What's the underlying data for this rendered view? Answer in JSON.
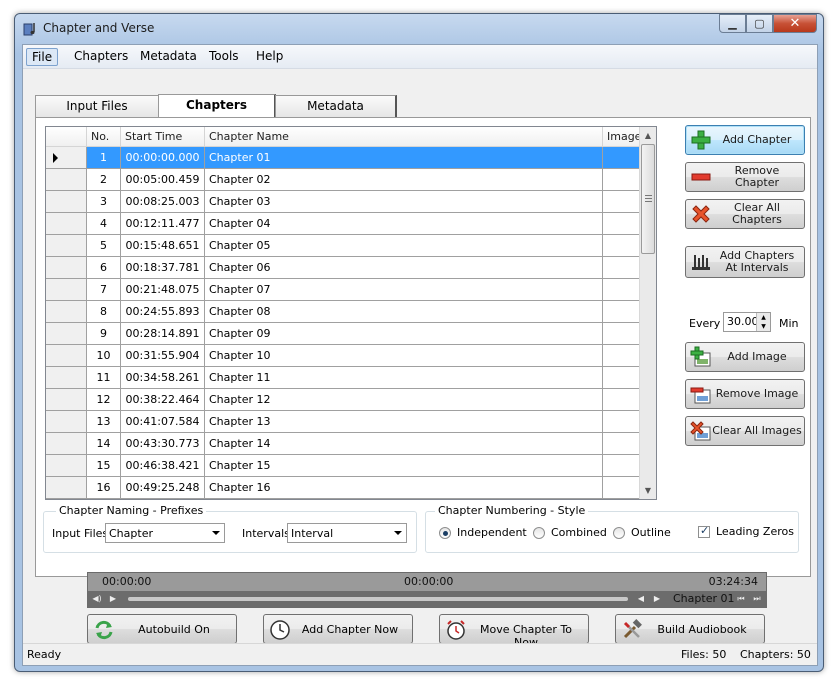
{
  "window": {
    "title": "Chapter and Verse"
  },
  "menu": [
    "File",
    "Chapters",
    "Metadata",
    "Tools",
    "Help"
  ],
  "tabs": [
    "Input Files",
    "Chapters",
    "Metadata"
  ],
  "grid": {
    "columns": [
      "No.",
      "Start Time",
      "Chapter Name",
      "Image"
    ],
    "rows": [
      {
        "no": "1",
        "time": "00:00:00.000",
        "name": "Chapter 01"
      },
      {
        "no": "2",
        "time": "00:05:00.459",
        "name": "Chapter 02"
      },
      {
        "no": "3",
        "time": "00:08:25.003",
        "name": "Chapter 03"
      },
      {
        "no": "4",
        "time": "00:12:11.477",
        "name": "Chapter 04"
      },
      {
        "no": "5",
        "time": "00:15:48.651",
        "name": "Chapter 05"
      },
      {
        "no": "6",
        "time": "00:18:37.781",
        "name": "Chapter 06"
      },
      {
        "no": "7",
        "time": "00:21:48.075",
        "name": "Chapter 07"
      },
      {
        "no": "8",
        "time": "00:24:55.893",
        "name": "Chapter 08"
      },
      {
        "no": "9",
        "time": "00:28:14.891",
        "name": "Chapter 09"
      },
      {
        "no": "10",
        "time": "00:31:55.904",
        "name": "Chapter 10"
      },
      {
        "no": "11",
        "time": "00:34:58.261",
        "name": "Chapter 11"
      },
      {
        "no": "12",
        "time": "00:38:22.464",
        "name": "Chapter 12"
      },
      {
        "no": "13",
        "time": "00:41:07.584",
        "name": "Chapter 13"
      },
      {
        "no": "14",
        "time": "00:43:30.773",
        "name": "Chapter 14"
      },
      {
        "no": "15",
        "time": "00:46:38.421",
        "name": "Chapter 15"
      },
      {
        "no": "16",
        "time": "00:49:25.248",
        "name": "Chapter 16"
      }
    ]
  },
  "side_buttons": {
    "add_chapter": "Add Chapter",
    "remove_chapter": "Remove Chapter",
    "clear_all_chapters": "Clear All Chapters",
    "add_chapters_intervals_1": "Add Chapters",
    "add_chapters_intervals_2": "At Intervals",
    "every_label": "Every",
    "interval_value": "30.00",
    "min_label": "Min",
    "add_image": "Add Image",
    "remove_image": "Remove Image",
    "clear_all_images": "Clear All Images"
  },
  "naming": {
    "group_title": "Chapter Naming - Prefixes",
    "input_files_label": "Input Files",
    "input_files_value": "Chapter",
    "intervals_label": "Intervals",
    "intervals_value": "Interval"
  },
  "numbering": {
    "group_title": "Chapter Numbering - Style",
    "options": [
      "Independent",
      "Combined",
      "Outline"
    ],
    "selected": "Independent",
    "leading_zeros": "Leading Zeros"
  },
  "player": {
    "time_left": "00:00:00",
    "time_center": "00:00:00",
    "time_right": "03:24:34",
    "chapter": "Chapter 01"
  },
  "actions": {
    "autobuild": "Autobuild On",
    "add_chapter_now": "Add Chapter Now",
    "move_chapter_to_now": "Move Chapter To Now",
    "build_audiobook": "Build Audiobook"
  },
  "status": {
    "state": "Ready",
    "files": "Files: 50",
    "chapters": "Chapters: 50"
  }
}
